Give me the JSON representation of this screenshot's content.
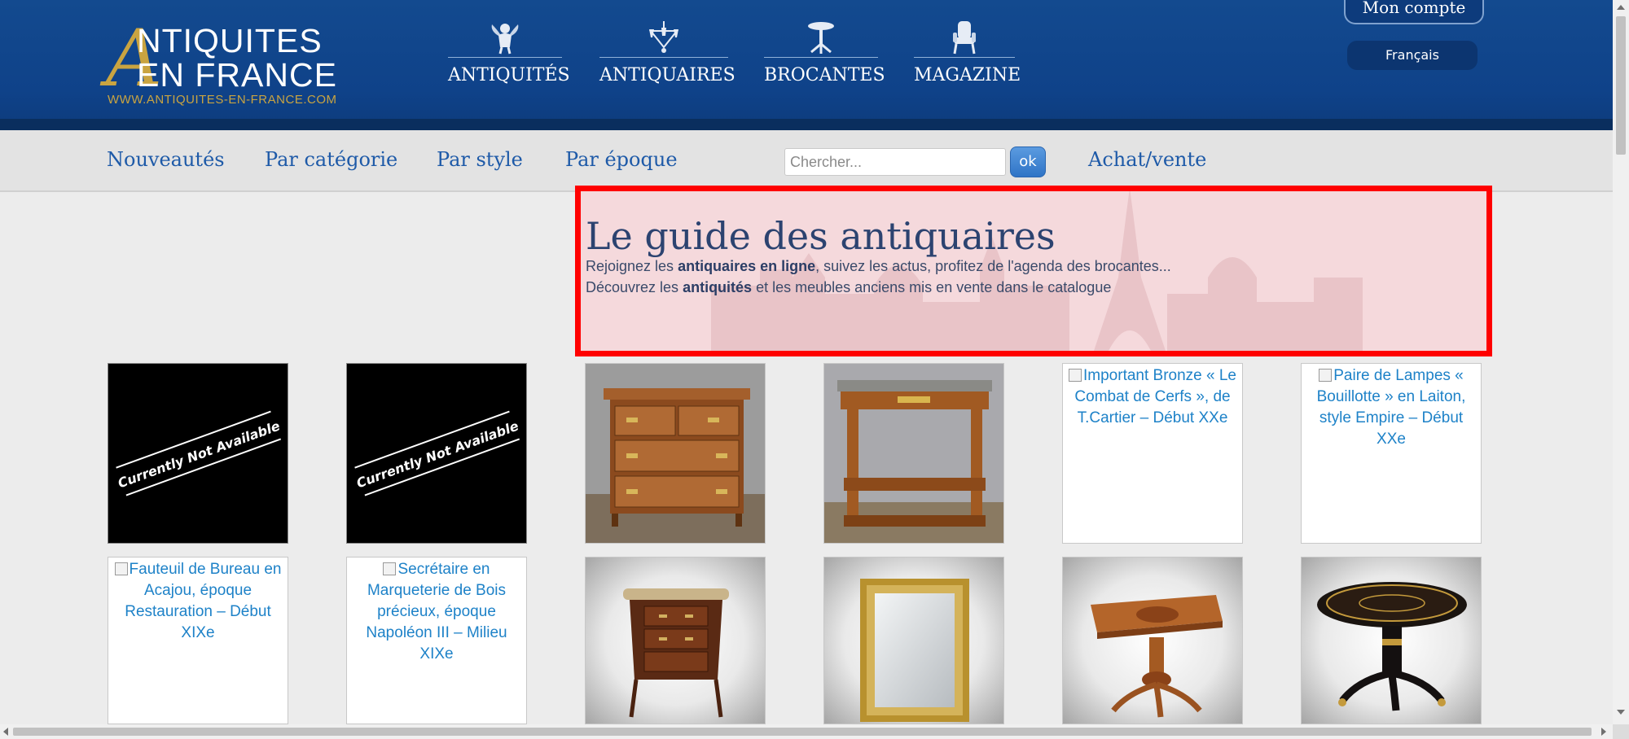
{
  "header": {
    "logo": {
      "letter_a": "A",
      "line1": "NTIQUITES",
      "line2": "EN FRANCE",
      "url": "WWW.ANTIQUITES-EN-FRANCE.COM"
    },
    "main_nav": [
      {
        "label": "ANTIQUITÉS",
        "icon": "cherub-icon"
      },
      {
        "label": "ANTIQUAIRES",
        "icon": "chandelier-icon"
      },
      {
        "label": "BROCANTES",
        "icon": "pedestal-table-icon"
      },
      {
        "label": "MAGAZINE",
        "icon": "armchair-icon"
      }
    ],
    "account_label": "Mon compte",
    "language_label": "Français"
  },
  "subnav": {
    "links": [
      "Nouveautés",
      "Par catégorie",
      "Par style",
      "Par époque"
    ],
    "search_placeholder": "Chercher...",
    "search_button": "ok",
    "buy_sell": "Achat/vente"
  },
  "hero": {
    "title": "Le guide des antiquaires",
    "line1_prefix": "Rejoignez les ",
    "line1_bold": "antiquaires en ligne",
    "line1_suffix": ", suivez les actus, profitez de l'agenda des brocantes...",
    "line2_prefix": "Découvrez les ",
    "line2_bold": "antiquités",
    "line2_suffix": " et les meubles anciens mis en vente dans le catalogue"
  },
  "products": {
    "unavailable_text": "Currently Not Available",
    "row1": [
      {
        "kind": "unavailable"
      },
      {
        "kind": "unavailable"
      },
      {
        "kind": "photo",
        "subject": "chest-of-drawers"
      },
      {
        "kind": "photo",
        "subject": "console-table"
      },
      {
        "kind": "broken",
        "alt": "Important Bronze « Le Combat de Cerfs », de T.Cartier – Début XXe"
      },
      {
        "kind": "broken",
        "alt": "Paire de Lampes « Bouillotte » en Laiton, style Empire – Début XXe"
      }
    ],
    "row2": [
      {
        "kind": "broken",
        "alt": "Fauteuil de Bureau en Acajou, époque Restauration – Début XIXe"
      },
      {
        "kind": "broken",
        "alt": "Secrétaire en Marqueterie de Bois précieux, époque Napoléon III – Milieu XIXe"
      },
      {
        "kind": "photo",
        "subject": "demilune-commode"
      },
      {
        "kind": "photo",
        "subject": "gilt-mirror"
      },
      {
        "kind": "photo",
        "subject": "pedestal-game-table"
      },
      {
        "kind": "photo",
        "subject": "boulle-table"
      }
    ]
  },
  "colors": {
    "header_blue": "#0f4289",
    "link_blue": "#1e5aa8",
    "highlight_red": "#ff0000",
    "gold": "#c9a441"
  }
}
